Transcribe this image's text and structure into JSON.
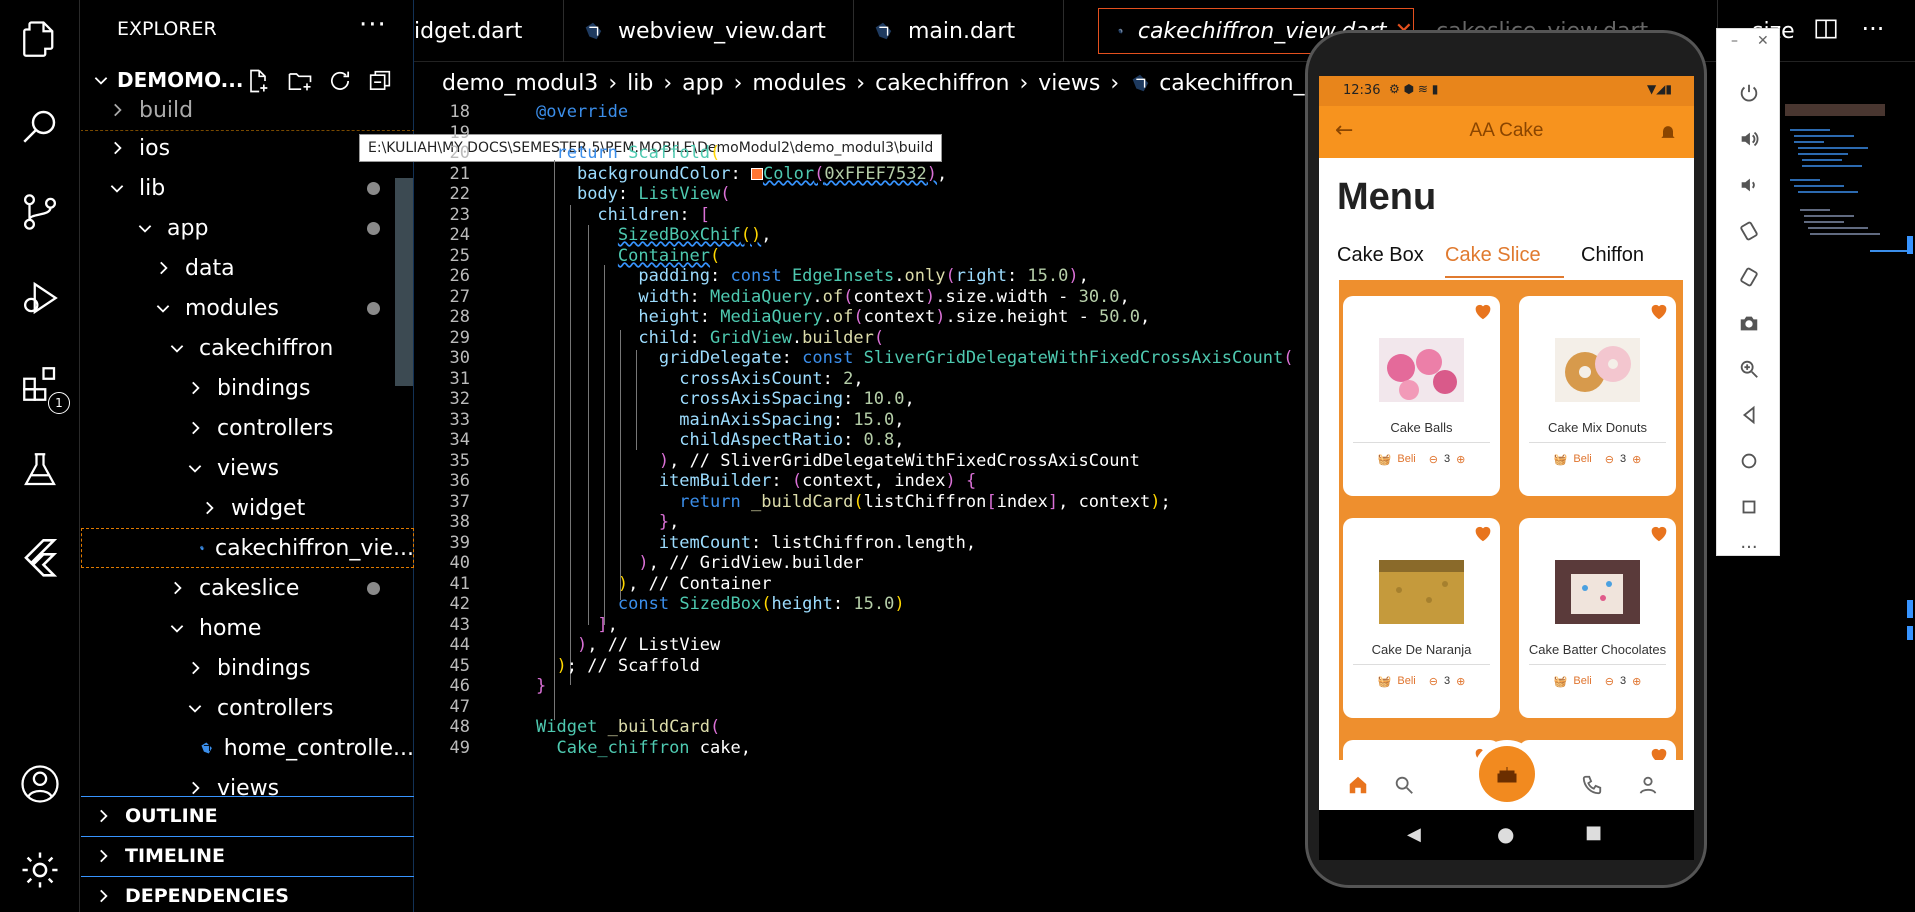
{
  "explorer": {
    "title": "EXPLORER",
    "project": "DEMOMO...",
    "tooltip": "E:\\KULIAH\\MY DOCS\\SEMESTER 5\\PEM.MOBILE\\DemoModul2\\demo_modul3\\build",
    "tree": {
      "build": "build",
      "ios": "ios",
      "lib": "lib",
      "app": "app",
      "data": "data",
      "modules": "modules",
      "cakechiffron": "cakechiffron",
      "bindings1": "bindings",
      "controllers1": "controllers",
      "views1": "views",
      "widget": "widget",
      "cakechiffron_view": "cakechiffron_vie...",
      "cakeslice": "cakeslice",
      "home": "home",
      "bindings2": "bindings",
      "controllers2": "controllers",
      "home_controller": "home_controlle...",
      "views2": "views"
    },
    "sections": {
      "outline": "OUTLINE",
      "timeline": "TIMELINE",
      "dependencies": "DEPENDENCIES"
    }
  },
  "activity": {
    "badge": "1"
  },
  "tabs": [
    "idget.dart",
    "webview_view.dart",
    "main.dart",
    "cakechiffron_view.dart",
    "cakeslice_view.dart",
    "size"
  ],
  "breadcrumb": [
    "demo_modul3",
    "lib",
    "app",
    "modules",
    "cakechiffron",
    "views",
    "cakechiffron_vie"
  ],
  "editor": {
    "line_numbers": [
      "18",
      "19",
      "20",
      "21",
      "22",
      "23",
      "24",
      "25",
      "26",
      "27",
      "28",
      "29",
      "30",
      "31",
      "32",
      "33",
      "34",
      "35",
      "36",
      "37",
      "38",
      "39",
      "40",
      "41",
      "42",
      "43",
      "44",
      "45",
      "46",
      "47",
      "48",
      "49"
    ]
  },
  "phone": {
    "time": "12:36",
    "app_title": "AA Cake",
    "menu_title": "Menu",
    "tabs": [
      "Cake Box",
      "Cake Slice",
      "Chiffon"
    ],
    "cards": [
      {
        "name": "Cake Balls",
        "buy": "Beli",
        "qty": "3"
      },
      {
        "name": "Cake Mix Donuts",
        "buy": "Beli",
        "qty": "3"
      },
      {
        "name": "Cake De Naranja",
        "buy": "Beli",
        "qty": "3"
      },
      {
        "name": "Cake Batter Chocolates",
        "buy": "Beli",
        "qty": "3"
      }
    ]
  },
  "colors": {
    "accent": "#f7931e",
    "cake_bg": "#ee8f2e",
    "editor_bg": "#000000",
    "tab_border": "#e4501e"
  }
}
